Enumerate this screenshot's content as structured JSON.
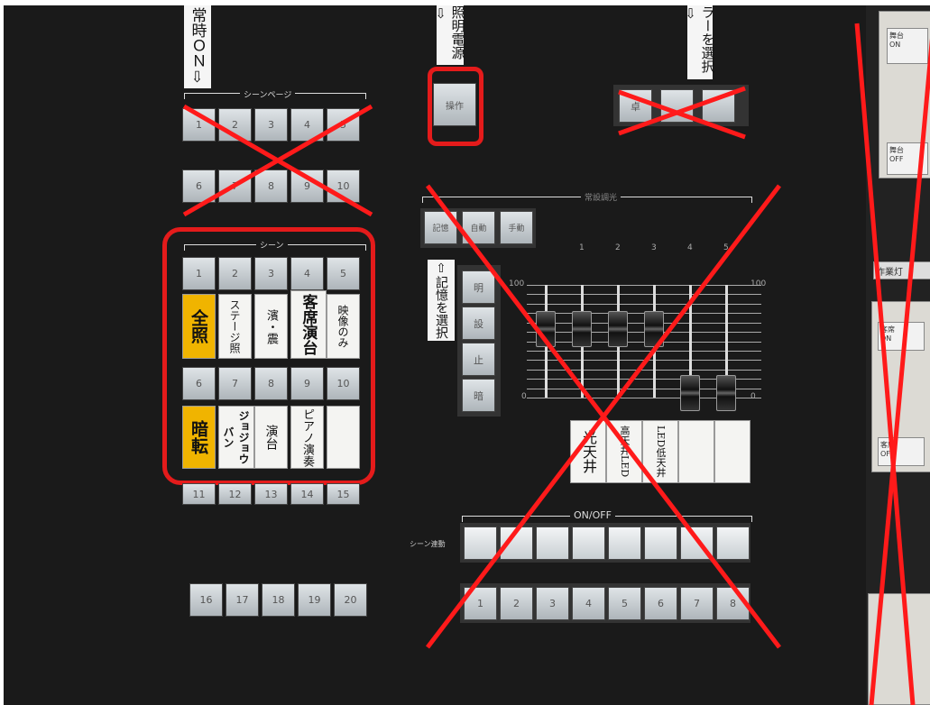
{
  "labels": {
    "always_on": "常時ＯＮ⇩",
    "power": "照明電源⇩",
    "select_top": "ラーを選択⇩",
    "memory_select": "⇧記憶を選択",
    "scene_page": "シーンページ",
    "scene": "シーン",
    "onoff": "ON/OFF",
    "scene_link": "シーン連動",
    "sofade_title": "常設調光",
    "work_light": "作業灯"
  },
  "buttons": {
    "power_op": "操作",
    "top_select": [
      "卓",
      "",
      ""
    ],
    "mode": [
      "記憶",
      "自動",
      "手動"
    ],
    "memory": [
      "明",
      "設",
      "止",
      "暗"
    ],
    "scene_page": [
      "1",
      "2",
      "3",
      "4",
      "5",
      "6",
      "7",
      "8",
      "9",
      "10"
    ],
    "scene_top": [
      "1",
      "2",
      "3",
      "4",
      "5"
    ],
    "scene_mid": [
      "6",
      "7",
      "8",
      "9",
      "10"
    ],
    "scene_low": [
      "11",
      "12",
      "13",
      "14",
      "15"
    ],
    "scene_bottom": [
      "16",
      "17",
      "18",
      "19",
      "20"
    ],
    "onoff": [
      "1",
      "2",
      "3",
      "4",
      "5",
      "6",
      "7",
      "8"
    ]
  },
  "scene_cards_top": [
    {
      "text": "全照",
      "yellow": true
    },
    {
      "text": "ステージ照"
    },
    {
      "text": "濱・震"
    },
    {
      "text": "客席演台"
    },
    {
      "text": "映像のみ"
    }
  ],
  "scene_cards_bottom": [
    {
      "text": "暗転",
      "yellow": true
    },
    {
      "text": "ジョジョウバン"
    },
    {
      "text": "演台"
    },
    {
      "text": "ピアノ演奏"
    },
    {
      "text": ""
    }
  ],
  "fader": {
    "numbers": [
      "1",
      "2",
      "3",
      "4",
      "5"
    ],
    "scale_top": "100",
    "scale_bottom": "0",
    "levels": [
      0.72,
      0.72,
      0.72,
      0.72,
      0.05,
      0.05
    ],
    "cards": [
      "光天井",
      "高天井LED",
      "LED低天井",
      "",
      ""
    ]
  },
  "side": {
    "box1": {
      "line1": "舞台",
      "line2": "ON"
    },
    "box2": {
      "line1": "舞台",
      "line2": "OFF"
    },
    "box3": {
      "line1": "客席",
      "line2": "ON"
    },
    "box4": {
      "line1": "客席",
      "line2": "OFF"
    }
  },
  "colors": {
    "annotation_red": "#ff1a1a",
    "panel": "#1a1a1a",
    "yellow": "#f0b400"
  }
}
